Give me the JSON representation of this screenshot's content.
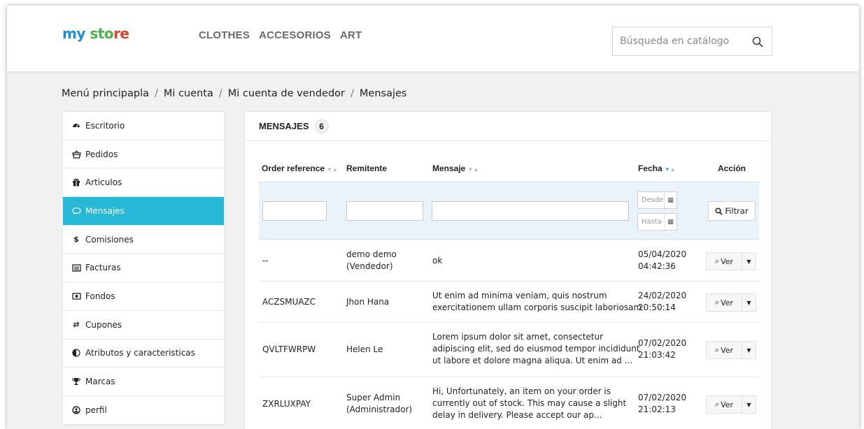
{
  "header": {
    "logo": {
      "part1": "my",
      "part2": " sto",
      "part3": "re"
    },
    "nav": [
      "CLOTHES",
      "ACCESORIOS",
      "ART"
    ],
    "search_placeholder": "Búsqueda en catálogo",
    "search_icon": "search-icon"
  },
  "breadcrumb": [
    "Menú principapla",
    "Mi cuenta",
    "Mi cuenta de vendedor",
    "Mensajes"
  ],
  "breadcrumb_sep": "/",
  "sidebar": {
    "items": [
      {
        "label": "Escritorio",
        "icon": "dashboard-icon"
      },
      {
        "label": "Pedidos",
        "icon": "basket-icon"
      },
      {
        "label": "Articulos",
        "icon": "gift-icon"
      },
      {
        "label": "Mensajes",
        "icon": "chat-icon",
        "active": true
      },
      {
        "label": "Comisiones",
        "icon": "dollar-icon"
      },
      {
        "label": "Facturas",
        "icon": "invoice-icon"
      },
      {
        "label": "Fondos",
        "icon": "money-icon"
      },
      {
        "label": "Cupones",
        "icon": "exchange-icon"
      },
      {
        "label": "Atributos y caracteristicas",
        "icon": "adjust-icon"
      },
      {
        "label": "Marcas",
        "icon": "trophy-icon"
      },
      {
        "label": "perfil",
        "icon": "user-icon"
      }
    ]
  },
  "panel": {
    "title": "MENSAJES",
    "count": "6",
    "columns": {
      "order_ref": "Order reference",
      "sender": "Remitente",
      "message": "Mensaje",
      "date": "Fecha",
      "action": "Acción"
    },
    "filters": {
      "date_from_placeholder": "Desde",
      "date_to_placeholder": "Hasta",
      "filter_button": "Filtrar"
    },
    "view_label": "Ver",
    "rows": [
      {
        "ref": "--",
        "sender": [
          "demo demo",
          "(Vendedor)"
        ],
        "message": [
          "ok"
        ],
        "date": [
          "05/04/2020",
          "04:42:36"
        ]
      },
      {
        "ref": "ACZSMUAZC",
        "sender": [
          "Jhon Hana"
        ],
        "message": [
          "Ut enim ad minima veniam, quis nostrum",
          "exercitationem ullam corporis suscipit laboriosam"
        ],
        "date": [
          "24/02/2020",
          "20:50:14"
        ]
      },
      {
        "ref": "QVLTFWRPW",
        "sender": [
          "Helen Le"
        ],
        "message": [
          "Lorem ipsum dolor sit amet, consectetur",
          "adipiscing elit, sed do eiusmod tempor incididunt",
          "ut labore et dolore magna aliqua. Ut enim ad ..."
        ],
        "date": [
          "07/02/2020",
          "21:03:42"
        ]
      },
      {
        "ref": "ZXRLUXPAY",
        "sender": [
          "Super Admin",
          "(Administrador)"
        ],
        "message": [
          "Hi, Unfortunately, an item on your order is",
          "currently out of stock. This may cause a slight",
          "delay in delivery. Please accept our ap..."
        ],
        "date": [
          "07/02/2020",
          "21:02:13"
        ]
      }
    ]
  }
}
